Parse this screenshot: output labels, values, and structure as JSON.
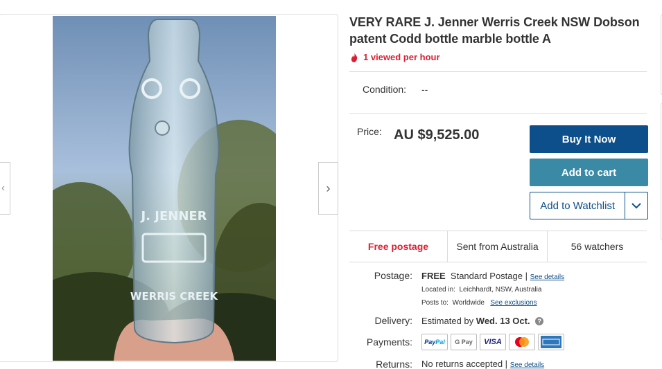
{
  "listing": {
    "title": "VERY RARE J. Jenner Werris Creek NSW Dobson patent Codd bottle marble bottle A",
    "viewed": "1 viewed per hour",
    "condition_label": "Condition:",
    "condition_value": "--",
    "price_label": "Price:",
    "price_value": "AU $9,525.00"
  },
  "actions": {
    "buy_now": "Buy It Now",
    "add_to_cart": "Add to cart",
    "add_to_watchlist": "Add to Watchlist"
  },
  "strip": {
    "free_postage": "Free postage",
    "sent_from": "Sent from Australia",
    "watchers": "56 watchers"
  },
  "details": {
    "postage_label": "Postage:",
    "postage_free": "FREE",
    "postage_type": "Standard Postage |",
    "see_details": "See details",
    "located_label": "Located in:",
    "located_value": "Leichhardt, NSW, Australia",
    "posts_label": "Posts to:",
    "posts_value": "Worldwide",
    "see_exclusions": "See exclusions",
    "delivery_label": "Delivery:",
    "delivery_prefix": "Estimated by",
    "delivery_date": "Wed. 13 Oct.",
    "payments_label": "Payments:",
    "payment_methods": [
      "PayPal",
      "G Pay",
      "VISA",
      "Mastercard",
      "American Express"
    ],
    "returns_label": "Returns:",
    "returns_value": "No returns accepted |",
    "returns_link": "See details"
  },
  "photo": {
    "embossing": [
      "J. JENNER",
      "WERRIS CREEK"
    ]
  },
  "colors": {
    "primary": "#0d4f8a",
    "cart": "#3a8aa6",
    "alert": "#dd1e31"
  },
  "icons": {
    "fire": "fire-icon",
    "prev": "chevron-left-icon",
    "next": "chevron-right-icon",
    "dropdown": "chevron-down-icon",
    "info": "info-icon"
  }
}
